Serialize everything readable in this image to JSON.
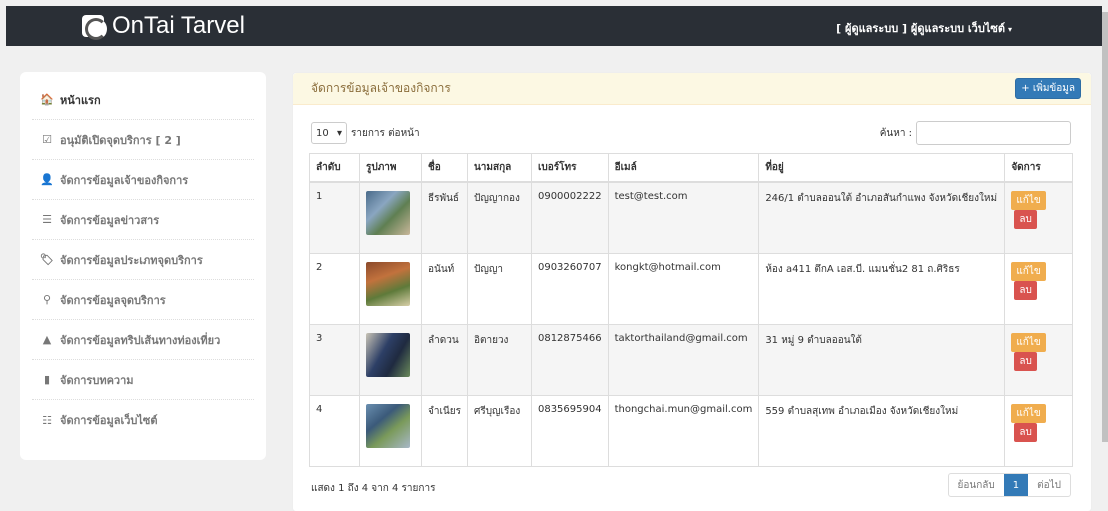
{
  "brand": {
    "name": "OnTai Tarvel"
  },
  "user_menu": {
    "label": "[ ผู้ดูแลระบบ ] ผู้ดูแลระบบ เว็บไซต์",
    "caret": "▾"
  },
  "sidebar": {
    "items": [
      {
        "label": "หน้าแรก",
        "icon": "home-icon",
        "glyph": "🏠"
      },
      {
        "label": "อนุมัติเปิดจุดบริการ [ 2 ]",
        "icon": "check-square-icon",
        "glyph": "☑"
      },
      {
        "label": "จัดการข้อมูลเจ้าของกิจการ",
        "icon": "user-icon",
        "glyph": "👤"
      },
      {
        "label": "จัดการข้อมูลข่าวสาร",
        "icon": "list-icon",
        "glyph": "☰"
      },
      {
        "label": "จัดการข้อมูลประเภทจุดบริการ",
        "icon": "tags-icon",
        "glyph": "🏷"
      },
      {
        "label": "จัดการข้อมูลจุดบริการ",
        "icon": "map-marker-icon",
        "glyph": "⚲"
      },
      {
        "label": "จัดการข้อมูลทริปเส้นทางท่องเที่ยว",
        "icon": "road-icon",
        "glyph": "▲"
      },
      {
        "label": "จัดการบทความ",
        "icon": "book-icon",
        "glyph": "▮"
      },
      {
        "label": "จัดการข้อมูลเว็บไซต์",
        "icon": "th-list-icon",
        "glyph": "☷"
      }
    ]
  },
  "panel": {
    "title": "จัดการข้อมูลเจ้าของกิจการ",
    "add_label": "+ เพิ่มข้อมูล"
  },
  "controls": {
    "length_value": "10",
    "length_caret": "▾",
    "length_label": "รายการ ต่อหน้า",
    "search_label": "ค้นหา :"
  },
  "table": {
    "headers": [
      "ลำดับ",
      "รูปภาพ",
      "ชื่อ",
      "นามสกุล",
      "เบอร์โทร",
      "อีเมล์",
      "ที่อยู่",
      "จัดการ"
    ],
    "rows": [
      {
        "no": "1",
        "first": "ธีรพันธ์",
        "last": "ปัญญากอง",
        "phone": "0900002222",
        "email": "test@test.com",
        "address": "246/1 ตำบลออนใต้ อำเภอสันกำแพง จังหวัดเชียงใหม่"
      },
      {
        "no": "2",
        "first": "อนันท์",
        "last": "ปัญญา",
        "phone": "0903260707",
        "email": "kongkt@hotmail.com",
        "address": "ห้อง a411 ตึกA เอส.บี. แมนชั่น2 81 ถ.ศิริธร"
      },
      {
        "no": "3",
        "first": "ลำดวน",
        "last": "อิตายวง",
        "phone": "0812875466",
        "email": "taktorthailand@gmail.com",
        "address": "31 หมู่ 9 ตำบลออนใต้"
      },
      {
        "no": "4",
        "first": "จำเนียร",
        "last": "ศรีบุญเรือง",
        "phone": "0835695904",
        "email": "thongchai.mun@gmail.com",
        "address": "559 ตำบลสุเทพ อำเภอเมือง จังหวัดเชียงใหม่"
      }
    ],
    "edit_label": "แก้ไข",
    "delete_label": "ลบ"
  },
  "footer": {
    "info": "แสดง 1 ถึง 4 จาก 4 รายการ",
    "prev": "ย้อนกลับ",
    "page": "1",
    "next": "ต่อไป"
  },
  "colors": {
    "navbar": "#2a2f36",
    "primary": "#337ab7",
    "warning": "#f0ad4e",
    "danger": "#d9534f",
    "heading_bg": "#fcf8e3"
  }
}
